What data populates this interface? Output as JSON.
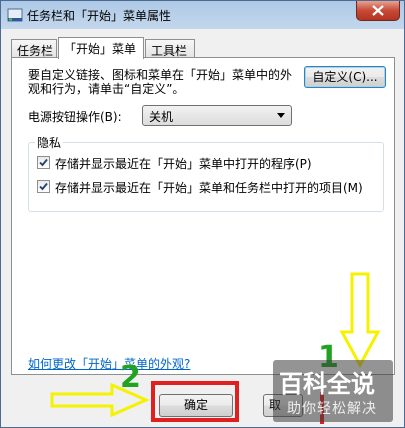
{
  "window": {
    "title": "任务栏和「开始」菜单属性"
  },
  "tabs": [
    {
      "label": "任务栏"
    },
    {
      "label": "「开始」菜单"
    },
    {
      "label": "工具栏"
    }
  ],
  "start_menu": {
    "description": "要自定义链接、图标和菜单在「开始」菜单中的外观和行为，请单击“自定义”。",
    "customize_button": "自定义(C)...",
    "power_label": "电源按钮操作(B):",
    "power_value": "关机",
    "privacy": {
      "label": "隐私",
      "options": [
        {
          "label": "存储并显示最近在「开始」菜单中打开的程序(P)",
          "checked": true
        },
        {
          "label": "存储并显示最近在「开始」菜单和任务栏中打开的项目(M)",
          "checked": true
        }
      ]
    },
    "help_link": "如何更改「开始」菜单的外观?"
  },
  "footer": {
    "ok_label": "确定",
    "cancel_label": "取"
  },
  "annotations": {
    "step_1": "1",
    "step_2": "2",
    "highlight_color": "#e02020",
    "arrow_color": "#f5f200",
    "number_color": "#21a321"
  },
  "watermark": {
    "main": "百科全说",
    "sub": "助你轻松解决"
  }
}
